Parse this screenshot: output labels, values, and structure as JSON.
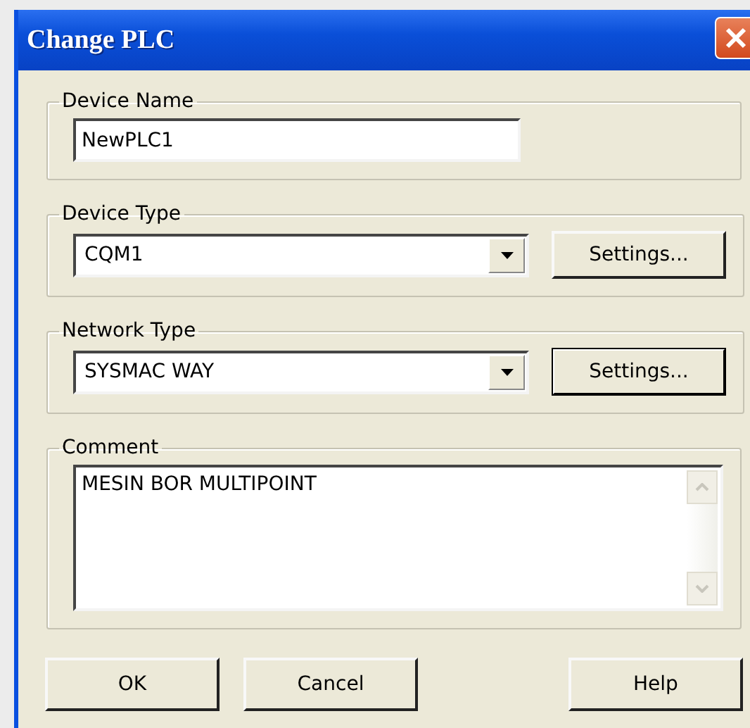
{
  "window": {
    "title": "Change PLC"
  },
  "device_name": {
    "label": "Device Name",
    "value": "NewPLC1"
  },
  "device_type": {
    "label": "Device Type",
    "value": "CQM1",
    "settings_button": {
      "label": "Settings...",
      "default": false
    }
  },
  "network_type": {
    "label": "Network Type",
    "value": "SYSMAC WAY",
    "settings_button": {
      "label": "Settings...",
      "default": true
    }
  },
  "comment": {
    "label": "Comment",
    "value": "MESIN BOR MULTIPOINT"
  },
  "buttons": [
    {
      "label": "OK"
    },
    {
      "label": "Cancel"
    },
    {
      "label": "Help"
    }
  ]
}
